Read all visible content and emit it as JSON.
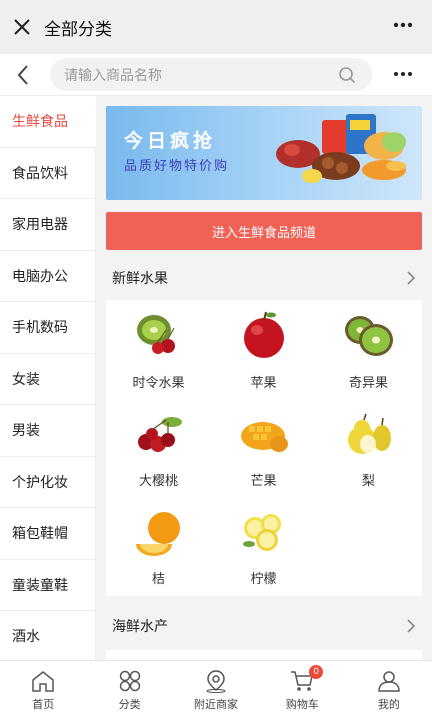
{
  "topbar": {
    "title": "全部分类",
    "close_icon": "close-icon",
    "more_icon": "more-icon"
  },
  "search": {
    "placeholder": "请输入商品名称"
  },
  "sidebar": {
    "items": [
      {
        "label": "生鲜食品",
        "active": true
      },
      {
        "label": "食品饮料"
      },
      {
        "label": "家用电器"
      },
      {
        "label": "电脑办公"
      },
      {
        "label": "手机数码"
      },
      {
        "label": "女装"
      },
      {
        "label": "男装"
      },
      {
        "label": "个护化妆"
      },
      {
        "label": "箱包鞋帽"
      },
      {
        "label": "童装童鞋"
      },
      {
        "label": "酒水"
      }
    ]
  },
  "banner": {
    "title": "今日疯抢",
    "subtitle": "品质好物特价购"
  },
  "channel_button": "进入生鲜食品频道",
  "sections": [
    {
      "title": "新鲜水果",
      "items": [
        {
          "label": "时令水果",
          "icon": "seasonal-fruit-icon"
        },
        {
          "label": "苹果",
          "icon": "apple-icon"
        },
        {
          "label": "奇异果",
          "icon": "kiwi-icon"
        },
        {
          "label": "大樱桃",
          "icon": "cherry-icon"
        },
        {
          "label": "芒果",
          "icon": "mango-icon"
        },
        {
          "label": "梨",
          "icon": "pear-icon"
        },
        {
          "label": "桔",
          "icon": "orange-icon"
        },
        {
          "label": "柠檬",
          "icon": "lemon-icon"
        }
      ]
    },
    {
      "title": "海鲜水产"
    }
  ],
  "tabbar": {
    "items": [
      {
        "label": "首页",
        "icon": "home-icon"
      },
      {
        "label": "分类",
        "icon": "category-icon"
      },
      {
        "label": "附近商家",
        "icon": "location-icon"
      },
      {
        "label": "购物车",
        "icon": "cart-icon",
        "badge": "0"
      },
      {
        "label": "我的",
        "icon": "user-icon"
      }
    ]
  },
  "colors": {
    "accent": "#e8473e",
    "button": "#f16155",
    "banner": "#79b9ee"
  }
}
